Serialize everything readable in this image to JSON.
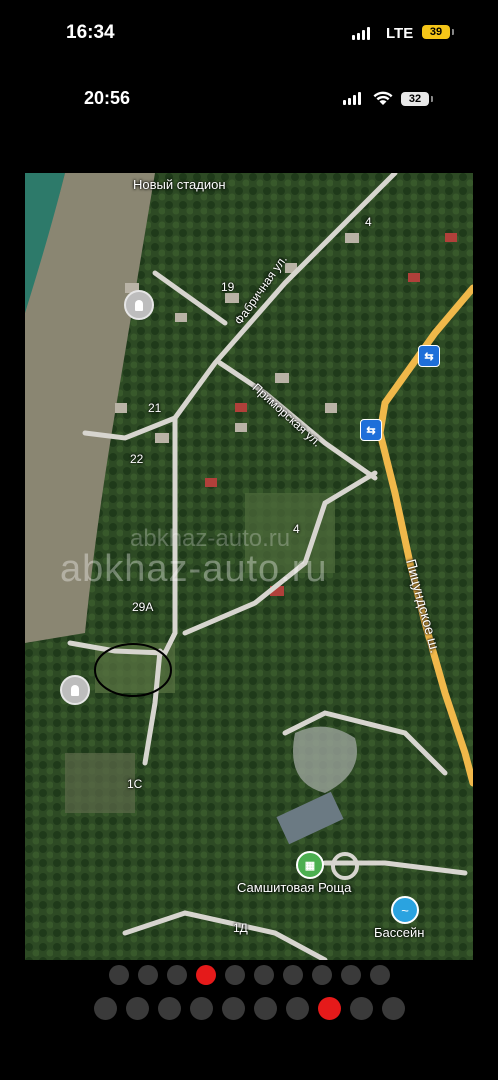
{
  "status_bar_outer": {
    "time": "16:34",
    "network": "LTE",
    "battery": "39",
    "battery_color": "#f5c518"
  },
  "status_bar_inner": {
    "time": "20:56",
    "battery": "32"
  },
  "map": {
    "labels": {
      "stadium": "Новый стадион",
      "factory_street": "Фабричная ул.",
      "primorskaya_street": "Приморская ул.",
      "pitsunda_highway": "Пицундское ш.",
      "grove": "Самшитовая Роща",
      "pool": "Бассейн",
      "n4a": "4",
      "n19": "19",
      "n21": "21",
      "n22": "22",
      "n4b": "4",
      "n29a": "29А",
      "n1c": "1С",
      "n1d": "1Д"
    },
    "watermark": "abkhaz-auto.ru",
    "icons": [
      "monument-icon",
      "bus-stop-icon",
      "park-icon",
      "swimming-icon"
    ]
  },
  "pagination_top": {
    "count": 10,
    "active": 4
  },
  "pagination_bottom": {
    "count": 10,
    "active": 8
  },
  "colors": {
    "active_dot": "#e51a1a",
    "inactive_dot": "#3a3a3a",
    "highway": "#f0b84a"
  }
}
